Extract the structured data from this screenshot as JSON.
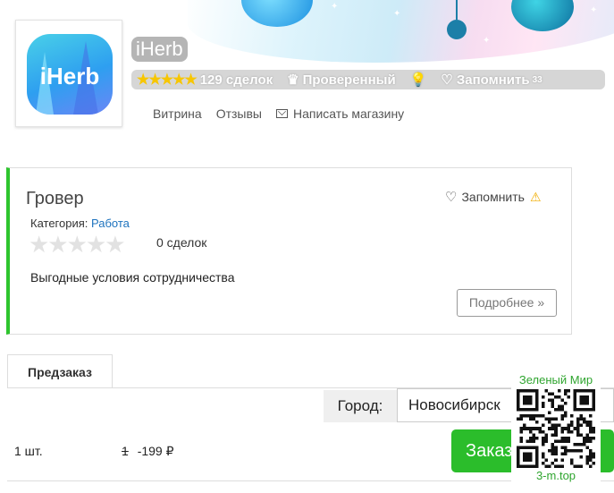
{
  "shop": {
    "logo_text": "iHerb",
    "name": "iHerb",
    "deals": "129 сделок",
    "verified": "Проверенный",
    "remember": "Запомнить",
    "remember_count": "33",
    "nav": [
      "Витрина",
      "Отзывы",
      "Написать магазину"
    ]
  },
  "offer": {
    "title": "Гровер",
    "remember": "Запомнить",
    "category_label": "Категория:",
    "category_value": "Работа",
    "deals": "0 сделок",
    "description": "Выгодные условия сотрудничества",
    "more_button": "Подробнее »"
  },
  "order": {
    "tab": "Предзаказ",
    "city_label": "Город:",
    "city_value": "Новосибирск",
    "qty": "1 шт.",
    "old_price": "1",
    "price": "-199 ₽",
    "order_button": "Заказать"
  },
  "watermark": {
    "top": "Зеленый Мир",
    "bottom": "3-m.top"
  },
  "icons": {
    "rating_stars": "star-icon",
    "verified": "crown-icon",
    "hint": "lightbulb-icon",
    "favorite": "heart-icon",
    "warning": "warning-icon",
    "message": "envelope-icon"
  },
  "colors": {
    "accent_green": "#2bbd2b",
    "link_blue": "#1e73be",
    "star_gold": "#f7c600",
    "warning": "#f0ad00"
  }
}
